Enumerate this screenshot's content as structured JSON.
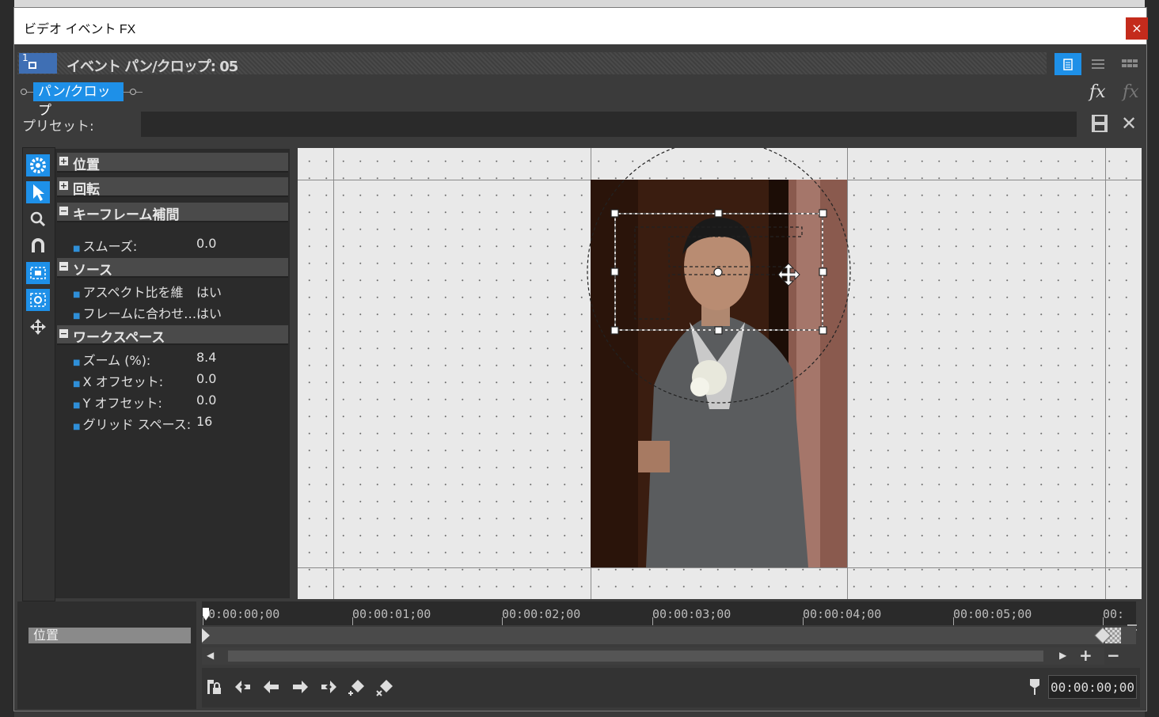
{
  "window": {
    "title": "ビデオ イベント FX",
    "close_label": "×"
  },
  "header": {
    "event_number": "1",
    "title": "イベント パン/クロップ: 05",
    "accent_color": "#1e90e8"
  },
  "plugin_chain": {
    "active_plugin": "パン/クロップ"
  },
  "preset": {
    "label": "プリセット:",
    "value": ""
  },
  "sections": [
    {
      "label": "位置",
      "expanded": false
    },
    {
      "label": "回転",
      "expanded": false
    },
    {
      "label": "キーフレーム補間",
      "expanded": true,
      "props": [
        {
          "name": "スムーズ:",
          "value": "0.0"
        }
      ]
    },
    {
      "label": "ソース",
      "expanded": true,
      "props": [
        {
          "name": "アスペクト比を維",
          "value": "はい"
        },
        {
          "name": "フレームに合わせ…",
          "value": "はい"
        }
      ]
    },
    {
      "label": "ワークスペース",
      "expanded": true,
      "props": [
        {
          "name": "ズーム (%):",
          "value": "8.4"
        },
        {
          "name": "X オフセット:",
          "value": "0.0"
        },
        {
          "name": "Y オフセット:",
          "value": "0.0"
        },
        {
          "name": "グリッド スペース:",
          "value": "16"
        }
      ]
    }
  ],
  "tools": [
    "gear-icon",
    "pointer-icon",
    "zoom-icon",
    "magnet-icon",
    "lock-aspect-icon",
    "snap-icon",
    "move-icon"
  ],
  "timeline": {
    "track_label": "位置",
    "ticks": [
      "0:00:00;00",
      "00:00:01;00",
      "00:00:02;00",
      "00:00:03;00",
      "00:00:04;00",
      "00:00:05;00",
      "00:"
    ],
    "current_time": "00:00:00;00",
    "zoom_in": "+",
    "zoom_out": "−"
  }
}
